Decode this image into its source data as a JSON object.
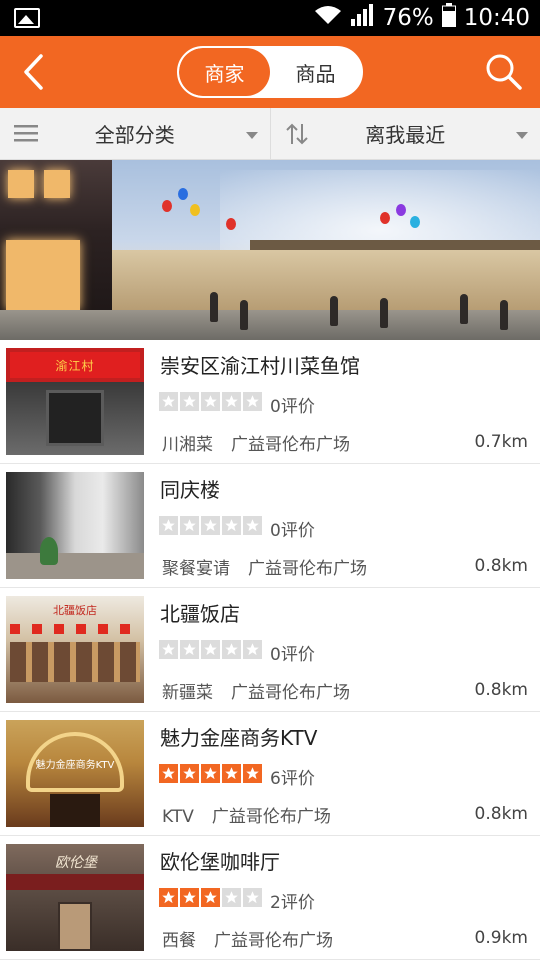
{
  "status_bar": {
    "battery": "76%",
    "time": "10:40",
    "icons": [
      "image-icon",
      "wifi-icon",
      "signal-icon",
      "battery-icon"
    ]
  },
  "header": {
    "back_icon": "chevron-left-icon",
    "tabs": [
      {
        "label": "商家",
        "active": true
      },
      {
        "label": "商品",
        "active": false
      }
    ],
    "search_icon": "search-icon"
  },
  "filters": {
    "category": {
      "label": "全部分类",
      "icon": "menu-icon"
    },
    "sort": {
      "label": "离我最近",
      "icon": "sort-icon"
    }
  },
  "banner": {
    "image": "shopping-plaza-banner"
  },
  "merchants": [
    {
      "name": "崇安区渝江村川菜鱼馆",
      "rating": 0,
      "reviews": "0评价",
      "category": "川湘菜",
      "location": "广益哥伦布广场",
      "distance": "0.7km",
      "thumb_sign": "渝江村"
    },
    {
      "name": "同庆楼",
      "rating": 0,
      "reviews": "0评价",
      "category": "聚餐宴请",
      "location": "广益哥伦布广场",
      "distance": "0.8km"
    },
    {
      "name": "北疆饭店",
      "rating": 0,
      "reviews": "0评价",
      "category": "新疆菜",
      "location": "广益哥伦布广场",
      "distance": "0.8km",
      "thumb_sign": "北疆饭店"
    },
    {
      "name": "魅力金座商务KTV",
      "rating": 5,
      "reviews": "6评价",
      "category": "KTV",
      "location": "广益哥伦布广场",
      "distance": "0.8km",
      "thumb_sign": "魅力金座商务KTV"
    },
    {
      "name": "欧伦堡咖啡厅",
      "rating": 3,
      "reviews": "2评价",
      "category": "西餐",
      "location": "广益哥伦布广场",
      "distance": "0.9km",
      "thumb_sign": "欧伦堡"
    }
  ],
  "colors": {
    "accent": "#f26722",
    "star_off": "#dcdcdc"
  }
}
